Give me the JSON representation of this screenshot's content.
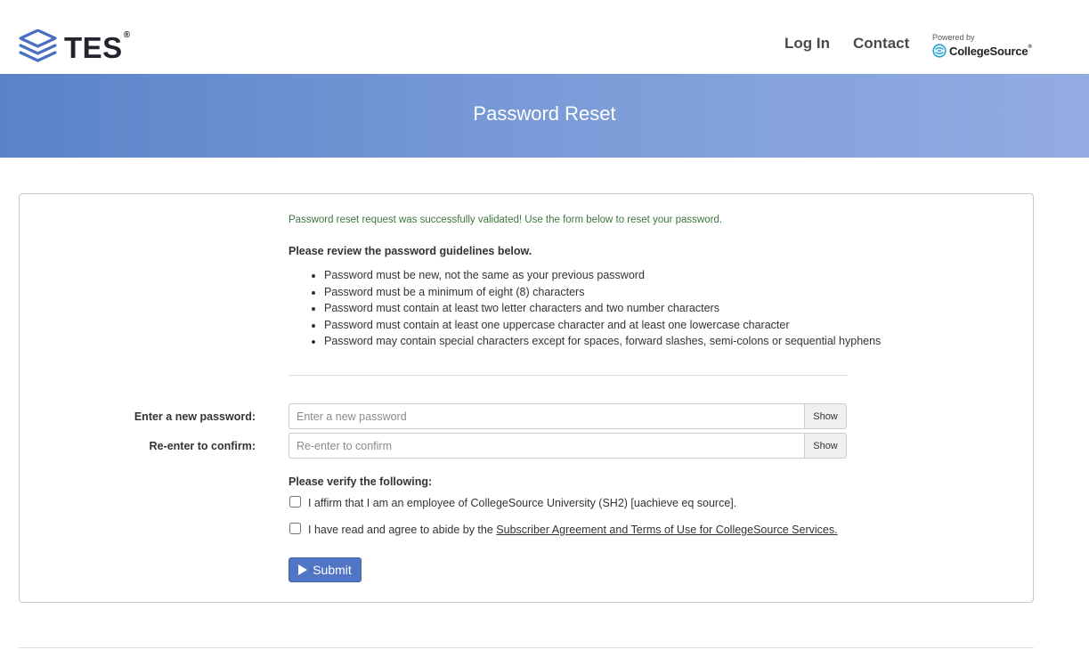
{
  "header": {
    "logo_text": "TES",
    "logo_reg": "®",
    "nav": {
      "login": "Log In",
      "contact": "Contact"
    },
    "powered_by": "Powered by",
    "partner_name": "CollegeSource",
    "partner_reg": "®"
  },
  "banner": {
    "title": "Password Reset"
  },
  "form": {
    "success_message": "Password reset request was successfully validated! Use the form below to reset your password.",
    "guidelines_title": "Please review the password guidelines below.",
    "guidelines": [
      "Password must be new, not the same as your previous password",
      "Password must be a minimum of eight (8) characters",
      "Password must contain at least two letter characters and two number characters",
      "Password must contain at least one uppercase character and at least one lowercase character",
      "Password may contain special characters except for spaces, forward slashes, semi-colons or sequential hyphens"
    ],
    "new_password": {
      "label": "Enter a new password:",
      "placeholder": "Enter a new password",
      "value": "",
      "show_label": "Show"
    },
    "confirm_password": {
      "label": "Re-enter to confirm:",
      "placeholder": "Re-enter to confirm",
      "value": "",
      "show_label": "Show"
    },
    "verify_title": "Please verify the following:",
    "affirm_text": "I affirm that I am an employee of CollegeSource University (SH2) [uachieve eq source].",
    "agree_prefix": "I have read and agree to abide by the ",
    "agree_link": "Subscriber Agreement and Terms of Use for CollegeSource Services.",
    "submit_label": "Submit"
  },
  "colors": {
    "banner_start": "#5b82c9",
    "banner_end": "#93ace2",
    "success_text": "#3c763d",
    "submit_bg": "#4f75c4"
  },
  "icons": [
    "tes-logo-icon",
    "collegesource-logo-icon",
    "play-icon"
  ]
}
